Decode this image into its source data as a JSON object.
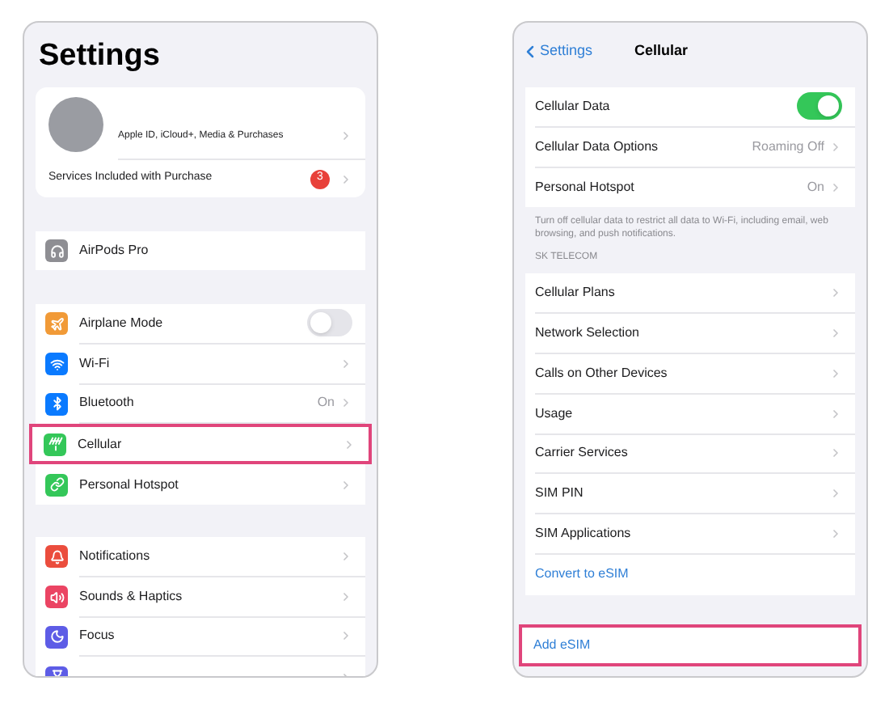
{
  "settings_screen": {
    "title": "Settings",
    "profile": {
      "subtitle": "Apple ID, iCloud+, Media & Purchases",
      "highlighted": false
    },
    "services_row": {
      "label": "Services Included with Purchase",
      "badge": "3",
      "highlighted": false
    },
    "device_row": {
      "label": "AirPods Pro",
      "color": "#8e8e93",
      "highlighted": false
    },
    "connectivity": [
      {
        "kind": "toggle",
        "label": "Airplane Mode",
        "color": "#f19a37",
        "on": false,
        "highlighted": false
      },
      {
        "kind": "link",
        "label": "Wi-Fi",
        "color": "#0a7aff",
        "highlighted": false
      },
      {
        "kind": "link",
        "label": "Bluetooth",
        "value": "On",
        "color": "#0a7aff",
        "highlighted": false
      },
      {
        "kind": "link",
        "label": "Cellular",
        "color": "#34c759",
        "highlighted": true
      },
      {
        "kind": "link",
        "label": "Personal Hotspot",
        "color": "#34c759",
        "highlighted": false
      }
    ],
    "general": [
      {
        "kind": "link",
        "label": "Notifications",
        "color": "#eb4d3d",
        "highlighted": false
      },
      {
        "kind": "link",
        "label": "Sounds & Haptics",
        "color": "#eb4463",
        "highlighted": false
      },
      {
        "kind": "link",
        "label": "Focus",
        "color": "#5d5ce6",
        "highlighted": false
      },
      {
        "kind": "link",
        "color": "#5d5ce6",
        "highlighted": false
      }
    ]
  },
  "cellular_screen": {
    "back": "Settings",
    "title": "Cellular",
    "data_rows": [
      {
        "kind": "toggle",
        "label": "Cellular Data",
        "on": true,
        "highlighted": false
      },
      {
        "kind": "link",
        "label": "Cellular Data Options",
        "value": "Roaming Off",
        "highlighted": false
      },
      {
        "kind": "link",
        "label": "Personal Hotspot",
        "value": "On",
        "highlighted": false
      }
    ],
    "footer": "Turn off cellular data to restrict all data to Wi-Fi, including email, web browsing, and push notifications.",
    "section_header": "SK TELECOM",
    "carrier_rows": [
      {
        "kind": "link",
        "label": "Cellular Plans",
        "highlighted": false
      },
      {
        "kind": "link",
        "label": "Network Selection",
        "highlighted": false
      },
      {
        "kind": "link",
        "label": "Calls on Other Devices",
        "highlighted": false
      },
      {
        "kind": "link",
        "label": "Usage",
        "highlighted": false
      },
      {
        "kind": "link",
        "label": "Carrier Services",
        "highlighted": false
      },
      {
        "kind": "link",
        "label": "SIM PIN",
        "highlighted": false
      },
      {
        "kind": "link",
        "label": "SIM Applications",
        "highlighted": false
      },
      {
        "kind": "action",
        "label": "Convert to eSIM",
        "highlighted": false
      }
    ],
    "esim_rows": [
      {
        "kind": "action",
        "label": "Add eSIM",
        "highlighted": true
      }
    ]
  }
}
